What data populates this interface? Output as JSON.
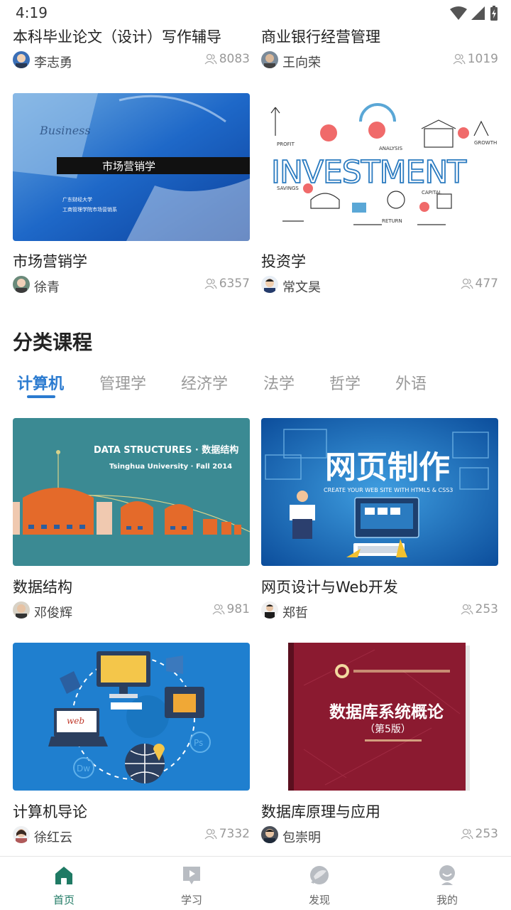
{
  "status": {
    "time": "4:19"
  },
  "top_courses": [
    {
      "title": "本科毕业论文（设计）写作辅导",
      "teacher": "李志勇",
      "learners": "8083"
    },
    {
      "title": "商业银行经营管理",
      "teacher": "王向荣",
      "learners": "1019"
    },
    {
      "title": "市场营销学",
      "teacher": "徐青",
      "learners": "6357",
      "cover": {
        "heading": "市场营销学",
        "line1": "广东财经大学",
        "line2": "工商管理学院市场营销系",
        "overlay": "Business"
      }
    },
    {
      "title": "投资学",
      "teacher": "常文昊",
      "learners": "477",
      "cover": {
        "heading": "INVESTMENT",
        "labels": [
          "PROFIT",
          "ANALYSIS",
          "GROWTH",
          "SAVINGS",
          "CAPITAL",
          "RETURN"
        ]
      }
    }
  ],
  "section": {
    "title": "分类课程"
  },
  "tabs": [
    {
      "label": "计算机",
      "active": true
    },
    {
      "label": "管理学"
    },
    {
      "label": "经济学"
    },
    {
      "label": "法学"
    },
    {
      "label": "哲学"
    },
    {
      "label": "外语"
    }
  ],
  "category_courses": [
    {
      "title": "数据结构",
      "teacher": "邓俊辉",
      "learners": "981",
      "cover": {
        "heading": "DATA STRUCTURES · 数据结构",
        "sub": "Tsinghua University · Fall 2014"
      }
    },
    {
      "title": "网页设计与Web开发",
      "teacher": "郑哲",
      "learners": "253",
      "cover": {
        "heading": "网页制作",
        "sub": "CREATE YOUR WEB SITE WITH HTML5 & CSS3"
      }
    },
    {
      "title": "计算机导论",
      "teacher": "徐红云",
      "learners": "7332",
      "cover": {
        "web": "web",
        "dw": "Dw",
        "ps": "Ps"
      }
    },
    {
      "title": "数据库原理与应用",
      "teacher": "包崇明",
      "learners": "253",
      "cover": {
        "heading": "数据库系统概论",
        "edition": "（第5版）"
      }
    }
  ],
  "nav": [
    {
      "label": "首页",
      "active": true
    },
    {
      "label": "学习"
    },
    {
      "label": "发现"
    },
    {
      "label": "我的"
    }
  ],
  "colors": {
    "accent": "#2b7bd0",
    "nav_active": "#1f7a64"
  }
}
